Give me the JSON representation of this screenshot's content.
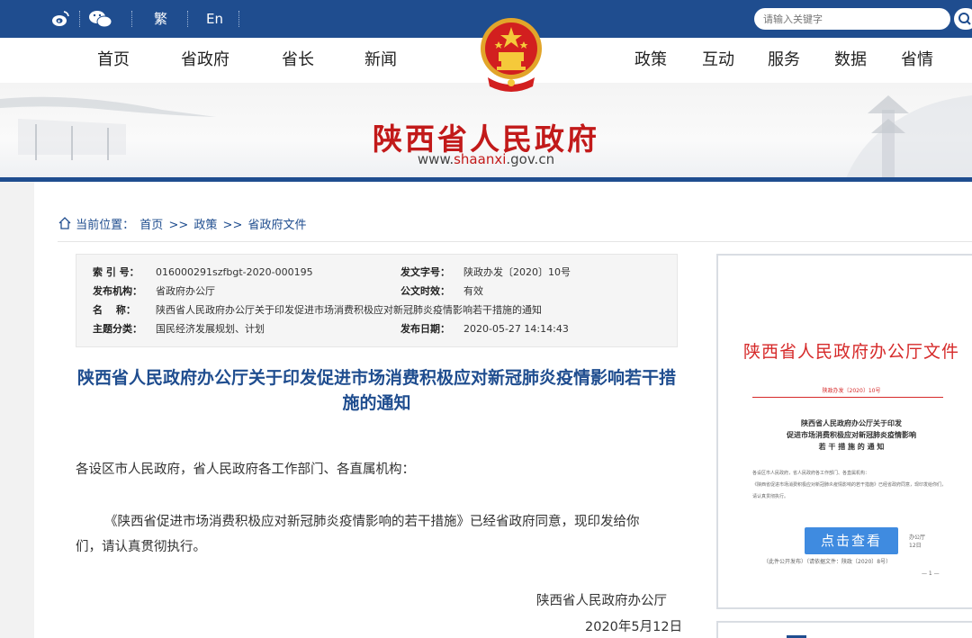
{
  "topbar": {
    "lang_traditional": "繁",
    "lang_english": "En",
    "search_placeholder": "请输入关键字"
  },
  "nav": {
    "left": [
      "首页",
      "省政府",
      "省长",
      "新闻"
    ],
    "right": [
      "政策",
      "互动",
      "服务",
      "数据",
      "省情"
    ]
  },
  "banner": {
    "title": "陕西省人民政府",
    "url_prefix": "www.",
    "url_accent": "shaanxi",
    "url_suffix": ".gov.cn"
  },
  "breadcrumb": {
    "label": "当前位置：",
    "items": [
      "首页",
      ">>",
      "政策",
      ">>",
      "省政府文件"
    ]
  },
  "meta": {
    "index_label": "索 引 号：",
    "index_value": "016000291szfbgt-2020-000195",
    "docno_label": "发文字号：",
    "docno_value": "陕政办发〔2020〕10号",
    "org_label": "发布机构：",
    "org_value": "省政府办公厅",
    "validity_label": "公文时效：",
    "validity_value": "有效",
    "name_label": "名　 称：",
    "name_value": "陕西省人民政府办公厅关于印发促进市场消费积极应对新冠肺炎疫情影响若干措施的通知",
    "topic_label": "主题分类：",
    "topic_value": "国民经济发展规划、计划",
    "date_label": "发布日期：",
    "date_value": "2020-05-27 14:14:43"
  },
  "document": {
    "title": "陕西省人民政府办公厅关于印发促进市场消费积极应对新冠肺炎疫情影响若干措施的通知",
    "salutation": "各设区市人民政府，省人民政府各工作部门、各直属机构：",
    "para1_line1": "《陕西省促进市场消费积极应对新冠肺炎疫情影响的若干措施》已经省政府同意，现印发给你",
    "para1_line2": "们，请认真贯彻执行。",
    "signature": "陕西省人民政府办公厅",
    "date": "2020年5月12日"
  },
  "preview": {
    "header": "陕西省人民政府办公厅文件",
    "docno": "陕政办发〔2020〕10号",
    "doc_title_lines": [
      "陕西省人民政府办公厅关于印发",
      "促进市场消费积极应对新冠肺炎疫情影响",
      "若 干 措 施 的 通 知"
    ],
    "body_lines": [
      "各设区市人民政府，省人民政府各工作部门、各直属机构：",
      "《陕西省促进市场消费积极应对新冠肺炎疫情影响的若干措施》已经省政府同意，现印发给你们，请认真贯彻执行。"
    ],
    "foot_org": "办公厅",
    "foot_date": "12日",
    "foot_note": "（此件公开发布）（请依据文件：陕政〔2020〕8号）",
    "page": "— 1 —",
    "view_button": "点击查看"
  },
  "colors": {
    "primary_blue": "#1f4d8f",
    "red": "#c21a1a",
    "button_blue": "#3f8be0"
  }
}
